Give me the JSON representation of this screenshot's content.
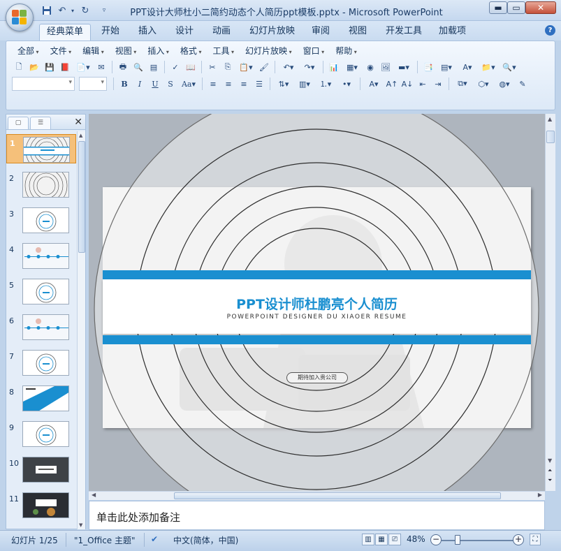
{
  "window": {
    "title": "PPT设计大师杜小二简约动态个人简历ppt模板.pptx - Microsoft PowerPoint",
    "quick_access": [
      "save-icon",
      "undo-icon",
      "redo-icon",
      "customize-icon"
    ]
  },
  "ribbon_tabs": [
    "经典菜单",
    "开始",
    "插入",
    "设计",
    "动画",
    "幻灯片放映",
    "审阅",
    "视图",
    "开发工具",
    "加载项"
  ],
  "classic_menu": [
    "全部",
    "文件",
    "编辑",
    "视图",
    "插入",
    "格式",
    "工具",
    "幻灯片放映",
    "窗口",
    "帮助"
  ],
  "slide": {
    "title": "PPT设计师杜鹏亮个人简历",
    "subtitle": "POWERPOINT DESIGNER DU XIAOER RESUME",
    "button": "期待加入贵公司",
    "accent_color": "#1a8fd0"
  },
  "thumbnails": [
    {
      "num": "1",
      "style": "rings-band"
    },
    {
      "num": "2",
      "style": "rings"
    },
    {
      "num": "3",
      "style": "circle"
    },
    {
      "num": "4",
      "style": "timeline"
    },
    {
      "num": "5",
      "style": "circle"
    },
    {
      "num": "6",
      "style": "timeline"
    },
    {
      "num": "7",
      "style": "circle"
    },
    {
      "num": "8",
      "style": "blue-diagonal"
    },
    {
      "num": "9",
      "style": "circle"
    },
    {
      "num": "10",
      "style": "dark"
    },
    {
      "num": "11",
      "style": "dark-photo"
    }
  ],
  "notes": {
    "placeholder": "单击此处添加备注"
  },
  "status": {
    "slide_indicator": "幻灯片 1/25",
    "theme": "\"1_Office 主题\"",
    "language": "中文(简体，中国)",
    "zoom": "48%"
  }
}
